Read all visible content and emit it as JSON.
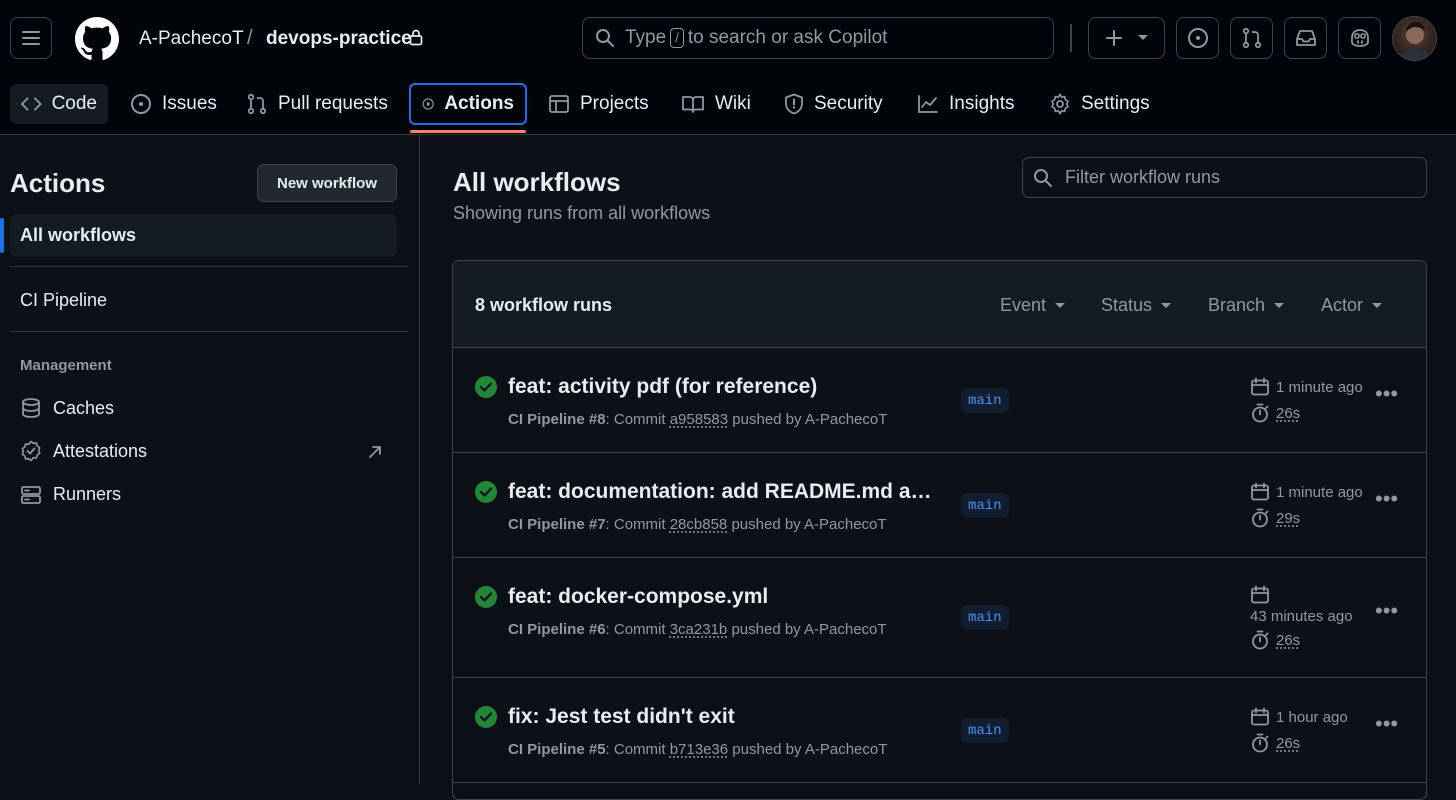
{
  "header": {
    "owner": "A-PachecoT",
    "separator": "/",
    "repo": "devops-practice",
    "search": {
      "prefix": "Type",
      "key": "/",
      "suffix": "to search or ask Copilot"
    }
  },
  "tabs": [
    {
      "label": "Code",
      "icon": "code-icon"
    },
    {
      "label": "Issues",
      "icon": "issue-icon"
    },
    {
      "label": "Pull requests",
      "icon": "pull-request-icon"
    },
    {
      "label": "Actions",
      "icon": "play-icon",
      "active": true
    },
    {
      "label": "Projects",
      "icon": "table-icon"
    },
    {
      "label": "Wiki",
      "icon": "book-icon"
    },
    {
      "label": "Security",
      "icon": "shield-icon"
    },
    {
      "label": "Insights",
      "icon": "graph-icon"
    },
    {
      "label": "Settings",
      "icon": "gear-icon"
    }
  ],
  "sidebar": {
    "title": "Actions",
    "new_workflow": "New workflow",
    "all_workflows": "All workflows",
    "workflows": [
      "CI Pipeline"
    ],
    "management_heading": "Management",
    "management": [
      {
        "label": "Caches",
        "icon": "database-icon"
      },
      {
        "label": "Attestations",
        "icon": "verified-icon"
      },
      {
        "label": "Runners",
        "icon": "server-icon"
      }
    ]
  },
  "main": {
    "title": "All workflows",
    "subtitle": "Showing runs from all workflows",
    "filter_placeholder": "Filter workflow runs",
    "runs_count": "8 workflow runs",
    "filters": [
      "Event",
      "Status",
      "Branch",
      "Actor"
    ],
    "runs": [
      {
        "title": "feat: activity pdf (for reference)",
        "workflow": "CI Pipeline",
        "number": "#8",
        "commit_label": ": Commit",
        "sha": "a958583",
        "pushed_by": "pushed by A-PachecoT",
        "branch": "main",
        "time": "1 minute ago",
        "duration": "26s"
      },
      {
        "title": "feat: documentation: add README.md and ...",
        "workflow": "CI Pipeline",
        "number": "#7",
        "commit_label": ": Commit",
        "sha": "28cb858",
        "pushed_by": "pushed by A-PachecoT",
        "branch": "main",
        "time": "1 minute ago",
        "duration": "29s"
      },
      {
        "title": "feat: docker-compose.yml",
        "workflow": "CI Pipeline",
        "number": "#6",
        "commit_label": ": Commit",
        "sha": "3ca231b",
        "pushed_by": "pushed by A-PachecoT",
        "branch": "main",
        "time": "43 minutes ago",
        "duration": "26s"
      },
      {
        "title": "fix: Jest test didn't exit",
        "workflow": "CI Pipeline",
        "number": "#5",
        "commit_label": ": Commit",
        "sha": "b713e36",
        "pushed_by": "pushed by A-PachecoT",
        "branch": "main",
        "time": "1 hour ago",
        "duration": "26s"
      }
    ]
  },
  "colors": {
    "success": "#238636",
    "accent": "#1f6feb",
    "active_underline": "#f78166",
    "branch_text": "#4493f8"
  }
}
